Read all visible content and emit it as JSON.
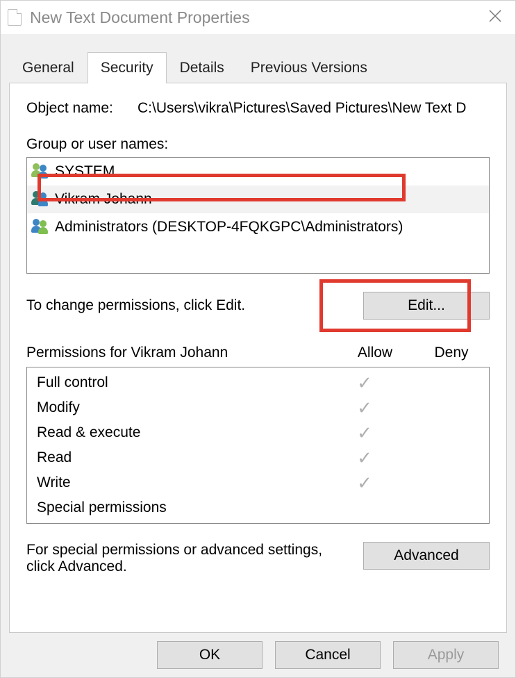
{
  "window": {
    "title": "New Text Document Properties"
  },
  "tabs": [
    "General",
    "Security",
    "Details",
    "Previous Versions"
  ],
  "active_tab": "Security",
  "object_name_label": "Object name:",
  "object_name_value": "C:\\Users\\vikra\\Pictures\\Saved Pictures\\New Text D",
  "group_label": "Group or user names:",
  "groups": [
    {
      "icon": "sys",
      "label": "SYSTEM"
    },
    {
      "icon": "user",
      "label": "Vikram Johann"
    },
    {
      "icon": "admin",
      "label": "Administrators (DESKTOP-4FQKGPC\\Administrators)"
    }
  ],
  "selected_group_index": 1,
  "edit_hint": "To change permissions, click Edit.",
  "edit_button": "Edit...",
  "perm_header_prefix": "Permissions for ",
  "perm_header_user": "Vikram Johann",
  "perm_col_allow": "Allow",
  "perm_col_deny": "Deny",
  "permissions": [
    {
      "name": "Full control",
      "allow": true,
      "deny": false
    },
    {
      "name": "Modify",
      "allow": true,
      "deny": false
    },
    {
      "name": "Read & execute",
      "allow": true,
      "deny": false
    },
    {
      "name": "Read",
      "allow": true,
      "deny": false
    },
    {
      "name": "Write",
      "allow": true,
      "deny": false
    },
    {
      "name": "Special permissions",
      "allow": false,
      "deny": false
    }
  ],
  "advanced_hint": "For special permissions or advanced settings, click Advanced.",
  "advanced_button": "Advanced",
  "footer": {
    "ok": "OK",
    "cancel": "Cancel",
    "apply": "Apply"
  },
  "highlight_color": "#e03a2f"
}
